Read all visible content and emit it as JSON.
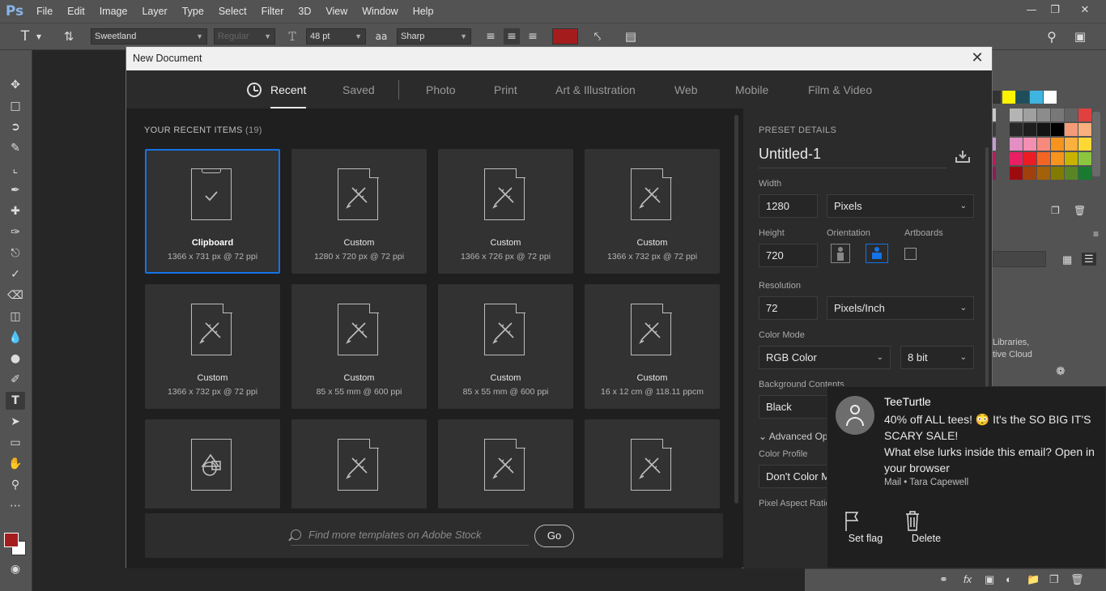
{
  "app": {
    "logo": "Ps",
    "menu": [
      "File",
      "Edit",
      "Image",
      "Layer",
      "Type",
      "Select",
      "Filter",
      "3D",
      "View",
      "Window",
      "Help"
    ]
  },
  "options": {
    "font_family": "Sweetland",
    "font_style": "Regular",
    "font_size": "48 pt",
    "antialias": "Sharp",
    "text_color": "#a51c1c"
  },
  "dialog": {
    "title": "New Document",
    "tabs": [
      "Recent",
      "Saved",
      "Photo",
      "Print",
      "Art & Illustration",
      "Web",
      "Mobile",
      "Film & Video"
    ],
    "recent_title": "YOUR RECENT ITEMS",
    "recent_count": "(19)",
    "items": [
      {
        "name": "Clipboard",
        "dims": "1366 x 731 px @ 72 ppi"
      },
      {
        "name": "Custom",
        "dims": "1280 x 720 px @ 72 ppi"
      },
      {
        "name": "Custom",
        "dims": "1366 x 726 px @ 72 ppi"
      },
      {
        "name": "Custom",
        "dims": "1366 x 732 px @ 72 ppi"
      },
      {
        "name": "Custom",
        "dims": "1366 x 732 px @ 72 ppi"
      },
      {
        "name": "Custom",
        "dims": "85 x 55 mm @ 600 ppi"
      },
      {
        "name": "Custom",
        "dims": "85 x 55 mm @ 600 ppi"
      },
      {
        "name": "Custom",
        "dims": "16 x 12 cm @ 118.11 ppcm"
      },
      {
        "name": "",
        "dims": ""
      },
      {
        "name": "",
        "dims": ""
      },
      {
        "name": "",
        "dims": ""
      },
      {
        "name": "",
        "dims": ""
      }
    ],
    "stock_placeholder": "Find more templates on Adobe Stock",
    "go_label": "Go"
  },
  "preset": {
    "heading": "PRESET DETAILS",
    "name": "Untitled-1",
    "width_label": "Width",
    "width_value": "1280",
    "width_unit": "Pixels",
    "height_label": "Height",
    "height_value": "720",
    "orientation_label": "Orientation",
    "artboards_label": "Artboards",
    "resolution_label": "Resolution",
    "resolution_value": "72",
    "resolution_unit": "Pixels/Inch",
    "color_mode_label": "Color Mode",
    "color_mode": "RGB Color",
    "bit_depth": "8 bit",
    "bg_label": "Background Contents",
    "bg_value": "Black",
    "advanced_label": "Advanced Op",
    "color_profile_label": "Color Profile",
    "color_profile_value": "Don't Color M",
    "pixel_aspect_label": "Pixel Aspect Ratio"
  },
  "libraries": {
    "line1": "Libraries,",
    "line2": "tive Cloud"
  },
  "notification": {
    "sender": "TeeTurtle",
    "message_line1": "40% off ALL tees! 😳 It's the SO BIG IT'S SCARY SALE!",
    "message_line2": "What else lurks inside this email? Open in your browser",
    "source": "Mail • Tara Capewell",
    "action_flag": "Set flag",
    "action_delete": "Delete"
  }
}
